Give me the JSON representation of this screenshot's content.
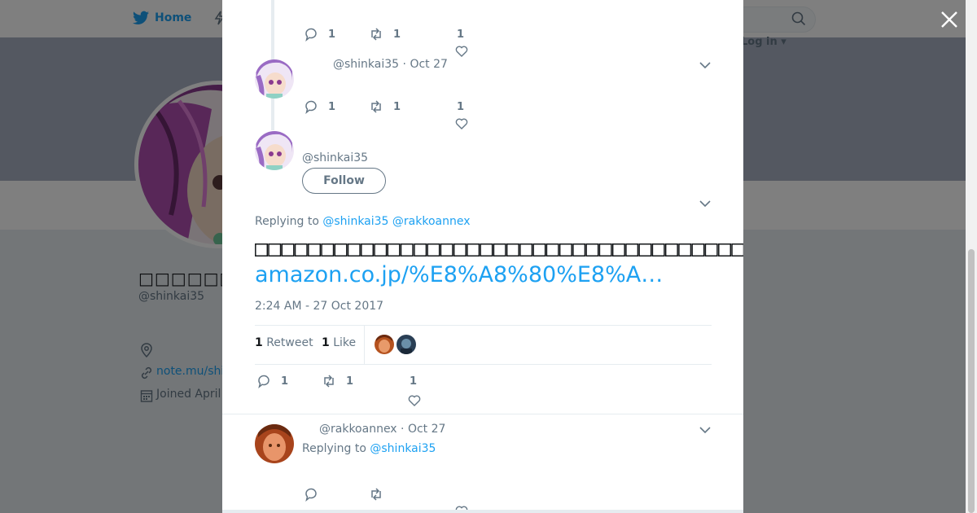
{
  "nav": {
    "home_label": "Home",
    "login_label": "Log in"
  },
  "profile": {
    "name": "□□□□□□□□□□",
    "handle": "@shinkai35",
    "link": "note.mu/shi",
    "joined": "Joined April"
  },
  "thread": {
    "prev_actions": {
      "replies": "1",
      "retweets": "1",
      "likes": "1"
    },
    "reply1": {
      "handle": "@shinkai35",
      "date": "Oct 27",
      "replies": "1",
      "retweets": "1",
      "likes": "1"
    }
  },
  "main_tweet": {
    "handle": "@shinkai35",
    "follow_label": "Follow",
    "replying_to_label": "Replying to",
    "replying_to_1": "@shinkai35",
    "replying_to_2": "@rakkoannex",
    "text": "□□□□□□□□□□□□□□□□□□□□□□□□□□□□□□□□□□□□□□□□□□□□□□□□□□□□□□□□□□□□□□",
    "link": "amazon.co.jp/%E8%A8%80%E8%A…",
    "timestamp": "2:24 AM - 27 Oct 2017",
    "retweet_count": "1",
    "retweet_label": "Retweet",
    "like_count": "1",
    "like_label": "Like",
    "actions": {
      "replies": "1",
      "retweets": "1",
      "likes": "1"
    }
  },
  "reply2": {
    "handle": "@rakkoannex",
    "date": "Oct 27",
    "replying_to_label": "Replying to",
    "replying_to": "@shinkai35"
  },
  "colors": {
    "accent": "#1da1f2",
    "muted": "#657786",
    "banner": "#a9b1c2"
  }
}
